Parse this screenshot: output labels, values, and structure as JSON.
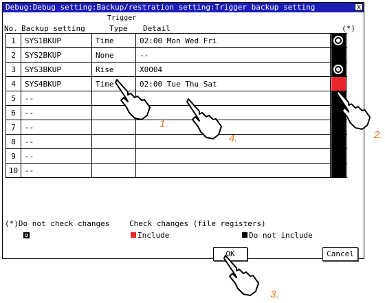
{
  "window": {
    "title": "Debug:Debug setting:Backup/restration setting:Trigger backup setting",
    "close_glyph": "X"
  },
  "columns": {
    "no": "No.",
    "backup": "Backup setting",
    "trigger_line1": "Trigger",
    "trigger_line2": "Type",
    "detail": "Detail",
    "status": "(*)"
  },
  "rows": [
    {
      "no": "1",
      "backup": "SYS1BKUP",
      "trigger": "Time",
      "detail": "02:00 Mon Wed Fri",
      "status": "check"
    },
    {
      "no": "2",
      "backup": "SYS2BKUP",
      "trigger": "None",
      "detail": "--",
      "status": "black"
    },
    {
      "no": "3",
      "backup": "SYS3BKUP",
      "trigger": "Rise",
      "detail": "X0004",
      "status": "check"
    },
    {
      "no": "4",
      "backup": "SYS4BKUP",
      "trigger": "Time",
      "detail": "02:00 Tue Thu Sat",
      "status": "red"
    },
    {
      "no": "5",
      "backup": "--",
      "trigger": "",
      "detail": "",
      "status": "black"
    },
    {
      "no": "6",
      "backup": "--",
      "trigger": "",
      "detail": "",
      "status": "black"
    },
    {
      "no": "7",
      "backup": "--",
      "trigger": "",
      "detail": "",
      "status": "black"
    },
    {
      "no": "8",
      "backup": "--",
      "trigger": "",
      "detail": "",
      "status": "black"
    },
    {
      "no": "9",
      "backup": "--",
      "trigger": "",
      "detail": "",
      "status": "black"
    },
    {
      "no": "10",
      "backup": "--",
      "trigger": "",
      "detail": "",
      "status": "black"
    }
  ],
  "legend": {
    "no_check": "(*)Do not check changes",
    "check_changes": "Check changes (file registers)",
    "include": "Include",
    "not_include": "Do not include"
  },
  "buttons": {
    "ok": "OK",
    "cancel": "Cancel"
  },
  "callouts": [
    "1.",
    "2.",
    "3.",
    "4."
  ],
  "colors": {
    "titlebar": "#1c1cb8",
    "include_red": "#e8262c",
    "callout_orange": "#e87722"
  }
}
